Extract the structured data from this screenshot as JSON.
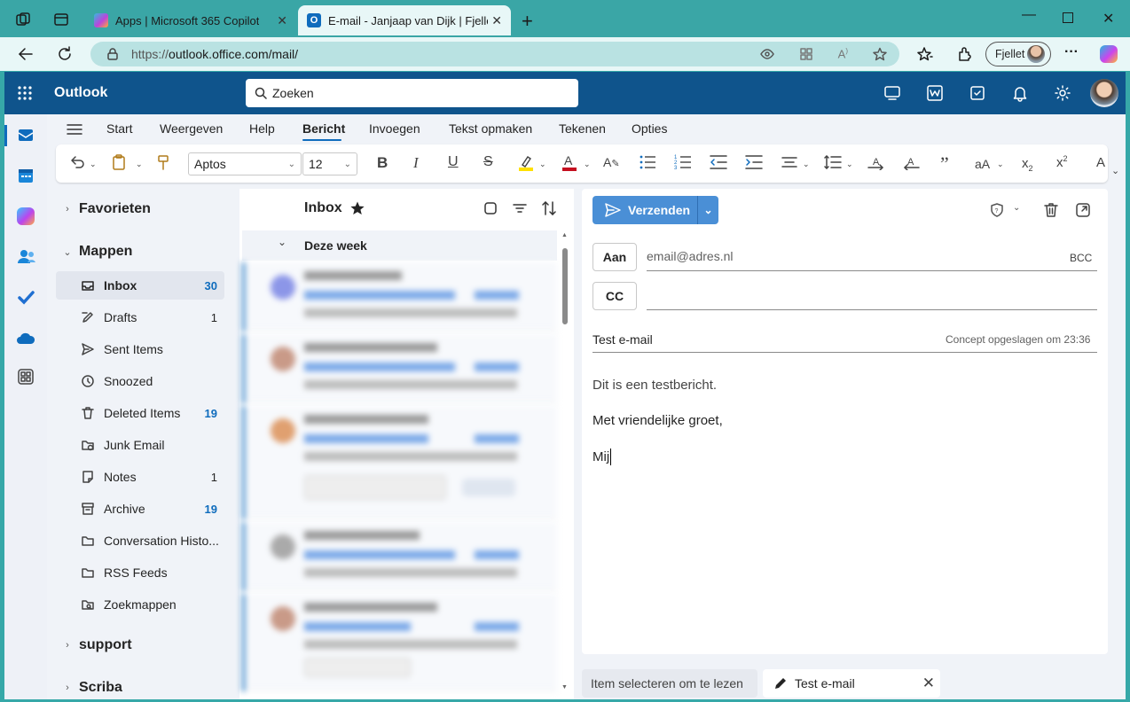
{
  "browser": {
    "tabs": [
      {
        "title": "Apps | Microsoft 365 Copilot"
      },
      {
        "title": "E-mail - Janjaap van Dijk | Fjellet -"
      }
    ],
    "url_scheme": "https://",
    "url_rest": "outlook.office.com/mail/",
    "profile_label": "Fjellet"
  },
  "app": {
    "name": "Outlook",
    "search_placeholder": "Zoeken"
  },
  "menu": [
    "Start",
    "Weergeven",
    "Help",
    "Bericht",
    "Invoegen",
    "Tekst opmaken",
    "Tekenen",
    "Opties"
  ],
  "menu_active": "Bericht",
  "ribbon": {
    "font": "Aptos",
    "size": "12"
  },
  "folders": {
    "favorites": "Favorieten",
    "mappen": "Mappen",
    "items": [
      {
        "label": "Inbox",
        "count": "30",
        "icon": "inbox-icon"
      },
      {
        "label": "Drafts",
        "count": "1",
        "icon": "pencil-icon"
      },
      {
        "label": "Sent Items",
        "count": "",
        "icon": "send-icon"
      },
      {
        "label": "Snoozed",
        "count": "",
        "icon": "clock-icon"
      },
      {
        "label": "Deleted Items",
        "count": "19",
        "icon": "trash-icon"
      },
      {
        "label": "Junk Email",
        "count": "",
        "icon": "junk-folder-icon"
      },
      {
        "label": "Notes",
        "count": "1",
        "icon": "note-icon"
      },
      {
        "label": "Archive",
        "count": "19",
        "icon": "archive-icon"
      },
      {
        "label": "Conversation Histo...",
        "count": "",
        "icon": "folder-icon"
      },
      {
        "label": "RSS Feeds",
        "count": "",
        "icon": "folder-icon"
      },
      {
        "label": "Zoekmappen",
        "count": "",
        "icon": "search-folder-icon"
      }
    ],
    "support": "support",
    "scriba": "Scriba"
  },
  "list": {
    "title": "Inbox",
    "group": "Deze week"
  },
  "compose": {
    "send_label": "Verzenden",
    "to_label": "Aan",
    "to_placeholder": "email@adres.nl",
    "bcc_label": "BCC",
    "cc_label": "CC",
    "subject": "Test e-mail",
    "saved_status": "Concept opgeslagen om 23:36",
    "body_line1": "Dit is een testbericht.",
    "body_line2": "Met vriendelijke groet,",
    "body_line3": "Mij"
  },
  "bottom": {
    "reading": "Item selecteren om te lezen",
    "draft_tab": "Test e-mail"
  }
}
